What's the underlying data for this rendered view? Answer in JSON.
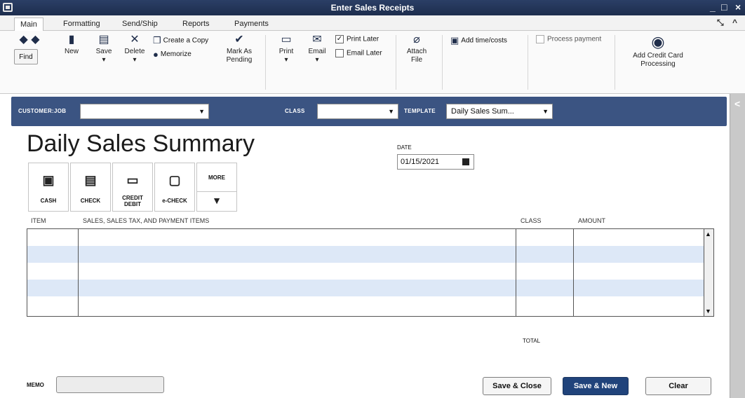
{
  "window": {
    "title": "Enter Sales Receipts"
  },
  "tabs": [
    "Main",
    "Formatting",
    "Send/Ship",
    "Reports",
    "Payments"
  ],
  "toolbar": {
    "find": "Find",
    "new": "New",
    "save": "Save",
    "delete": "Delete",
    "create_copy": "Create a Copy",
    "memorize": "Memorize",
    "mark_as": "Mark As",
    "pending": "Pending",
    "print": "Print",
    "email": "Email",
    "print_later": "Print Later",
    "email_later": "Email Later",
    "attach": "Attach",
    "file": "File",
    "add_time_costs": "Add time/costs",
    "process_payment": "Process payment",
    "add_credit_card": "Add Credit Card",
    "processing": "Processing"
  },
  "header": {
    "customer_job_label": "CUSTOMER:JOB",
    "customer_job_value": "",
    "class_label": "CLASS",
    "class_value": "",
    "template_label": "TEMPLATE",
    "template_value": "Daily Sales Sum..."
  },
  "form": {
    "title": "Daily Sales Summary",
    "date_label": "DATE",
    "date_value": "01/15/2021"
  },
  "payment_methods": {
    "cash": "CASH",
    "check": "CHECK",
    "credit": "CREDIT",
    "debit": "DEBIT",
    "echeck": "e-CHECK",
    "more": "MORE"
  },
  "table": {
    "columns": [
      "ITEM",
      "SALES, SALES TAX, AND PAYMENT ITEMS",
      "CLASS",
      "AMOUNT"
    ]
  },
  "footer": {
    "total_label": "TOTAL",
    "memo_label": "MEMO",
    "save_close": "Save & Close",
    "save_new": "Save & New",
    "clear": "Clear"
  }
}
